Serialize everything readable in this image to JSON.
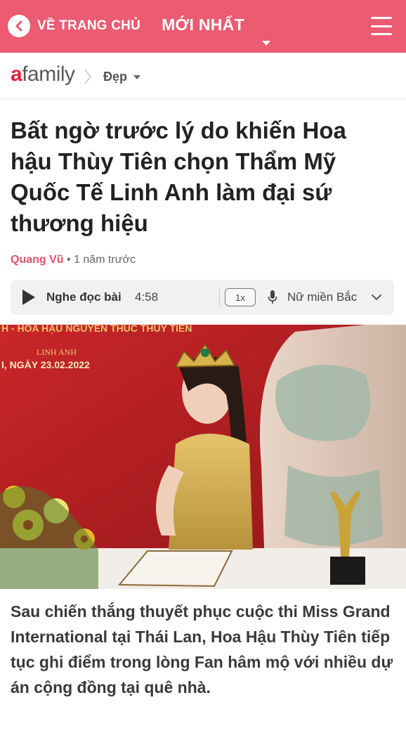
{
  "topbar": {
    "back_label": "VỀ TRANG CHỦ",
    "newest_label": "MỚI NHẤT",
    "color": "#ec5b72"
  },
  "breadcrumb": {
    "logo_a": "a",
    "logo_rest": "family",
    "category": "Đẹp"
  },
  "article": {
    "title": "Bất ngờ trước lý do khiến Hoa hậu Thùy Tiên chọn Thẩm Mỹ Quốc Tế Linh Anh làm đại sứ thương hiệu",
    "author": "Quang Vũ",
    "meta_sep": " • ",
    "published": "1 năm trước",
    "lead": "Sau chiến thắng thuyết phục cuộc thi Miss Grand International tại Thái Lan, Hoa Hậu Thùy Tiên tiếp tục ghi điểm trong lòng Fan hâm mộ với nhiều dự án cộng đồng tại quê nhà."
  },
  "player": {
    "label": "Nghe đọc bài",
    "duration": "4:58",
    "speed": "1x",
    "voice": "Nữ miền Bắc"
  },
  "hero": {
    "banner_line1": "H - HOA HẬU NGUYỄN THÚC THÙY TIÊN",
    "banner_brand": "LINH ANH",
    "banner_date": "I, NGÀY 23.02.2022"
  },
  "icons": {
    "back": "chevron-left-icon",
    "menu": "hamburger-icon",
    "play": "play-icon",
    "mic": "microphone-icon",
    "dropdown": "chevron-down-icon"
  }
}
